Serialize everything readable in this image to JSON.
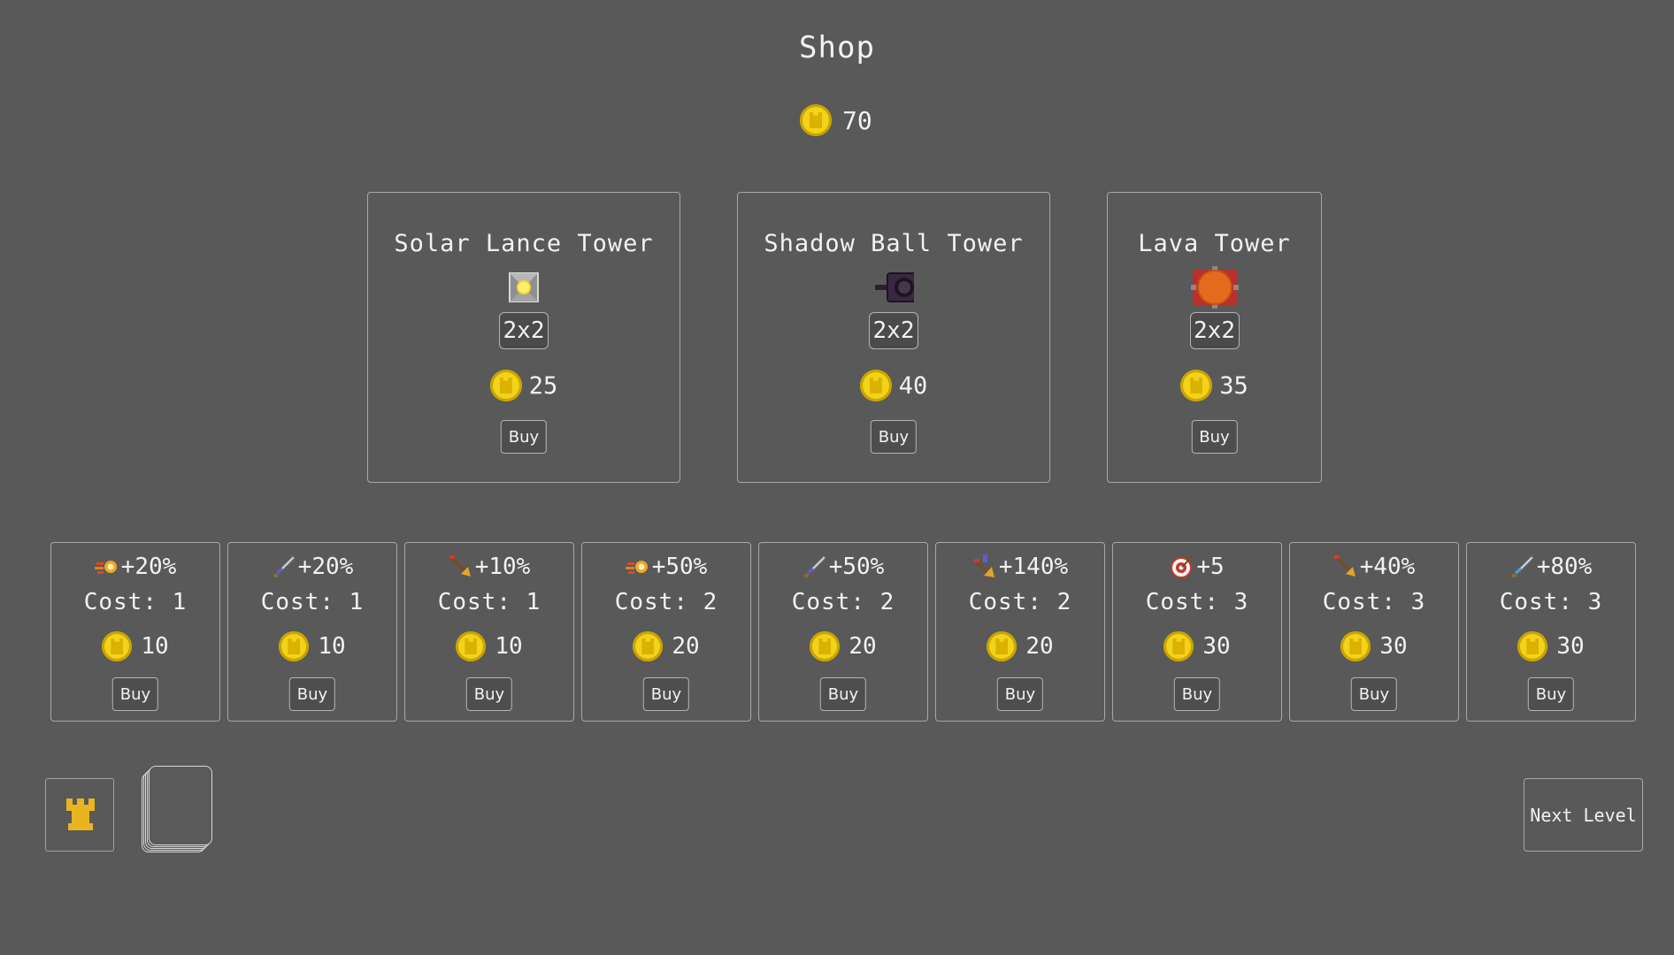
{
  "title": "Shop",
  "gold": "70",
  "towers": [
    {
      "name": "Solar Lance Tower",
      "icon": "solar-lance-tower-icon",
      "size": "2x2",
      "price": "25",
      "buy_label": "Buy"
    },
    {
      "name": "Shadow Ball Tower",
      "icon": "shadow-ball-tower-icon",
      "size": "2x2",
      "price": "40",
      "buy_label": "Buy"
    },
    {
      "name": "Lava Tower",
      "icon": "lava-tower-icon",
      "size": "2x2",
      "price": "35",
      "buy_label": "Buy"
    }
  ],
  "upgrades": [
    {
      "icon": "fireball-icon",
      "effect": "+20%",
      "cost": "Cost: 1",
      "price": "10",
      "buy_label": "Buy"
    },
    {
      "icon": "sword-icon",
      "effect": "+20%",
      "cost": "Cost: 1",
      "price": "10",
      "buy_label": "Buy"
    },
    {
      "icon": "arrow-icon",
      "effect": "+10%",
      "cost": "Cost: 1",
      "price": "10",
      "buy_label": "Buy"
    },
    {
      "icon": "fireball-icon",
      "effect": "+50%",
      "cost": "Cost: 2",
      "price": "20",
      "buy_label": "Buy"
    },
    {
      "icon": "sword-icon",
      "effect": "+50%",
      "cost": "Cost: 2",
      "price": "20",
      "buy_label": "Buy"
    },
    {
      "icon": "crossbow-icon",
      "effect": "+140%",
      "cost": "Cost: 2",
      "price": "20",
      "buy_label": "Buy"
    },
    {
      "icon": "target-icon",
      "effect": "+5",
      "cost": "Cost: 3",
      "price": "30",
      "buy_label": "Buy"
    },
    {
      "icon": "arrow-icon",
      "effect": "+40%",
      "cost": "Cost: 3",
      "price": "30",
      "buy_label": "Buy"
    },
    {
      "icon": "sword-icon",
      "effect": "+80%",
      "cost": "Cost: 3",
      "price": "30",
      "buy_label": "Buy"
    }
  ],
  "bottom": {
    "tower_icon": "castle-tower-icon",
    "deck_icon": "card-deck-icon",
    "next_level_label": "Next Level"
  },
  "colors": {
    "background": "#595959",
    "gold": "#f3d21a",
    "tower_slot_icon": "#e8b520",
    "lava": "#e46b1c",
    "lava_base": "#b8312d",
    "shadow": "#3a2740"
  }
}
